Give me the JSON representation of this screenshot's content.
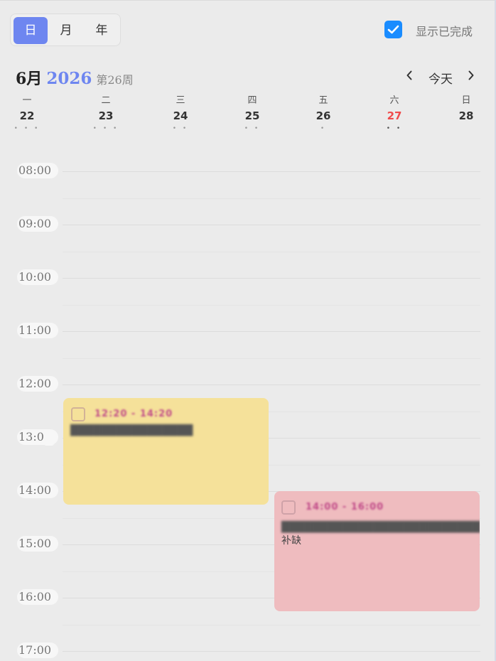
{
  "view_switch": {
    "options": [
      {
        "label": "日",
        "active": true
      },
      {
        "label": "月",
        "active": false
      },
      {
        "label": "年",
        "active": false
      }
    ]
  },
  "show_completed": {
    "label": "显示已完成",
    "checked": true
  },
  "header": {
    "month": "6月",
    "year": "2026",
    "week": "第26周",
    "today_label": "今天",
    "prev_icon": "chevron-left-icon",
    "next_icon": "chevron-right-icon"
  },
  "week_days": [
    {
      "weekday": "一",
      "date": "22",
      "dots": "• • •"
    },
    {
      "weekday": "二",
      "date": "23",
      "dots": "• • •"
    },
    {
      "weekday": "三",
      "date": "24",
      "dots": "• •"
    },
    {
      "weekday": "四",
      "date": "25",
      "dots": "• •"
    },
    {
      "weekday": "五",
      "date": "26",
      "dots": "•"
    },
    {
      "weekday": "六",
      "date": "27",
      "dots": "• •"
    },
    {
      "weekday": "日",
      "date": "28",
      "dots": ""
    }
  ],
  "hours": [
    "08:00",
    "09:00",
    "10:00",
    "11:00",
    "12:00",
    "13:00",
    "14:00",
    "15:00",
    "16:00",
    "17:00"
  ],
  "events": [
    {
      "color": "#f5e19a",
      "time": "12:20 - 14:20",
      "title": "████████████████",
      "title_suffix": ""
    },
    {
      "color": "#efbcbf",
      "time": "14:00 - 16:00",
      "title": "██████████████████████████",
      "title_suffix": "补缺"
    }
  ],
  "colors": {
    "accent": "#6e86f0",
    "checkbox": "#1a8cff",
    "saturday": "#f04b4b",
    "event_time": "#c04a88"
  }
}
